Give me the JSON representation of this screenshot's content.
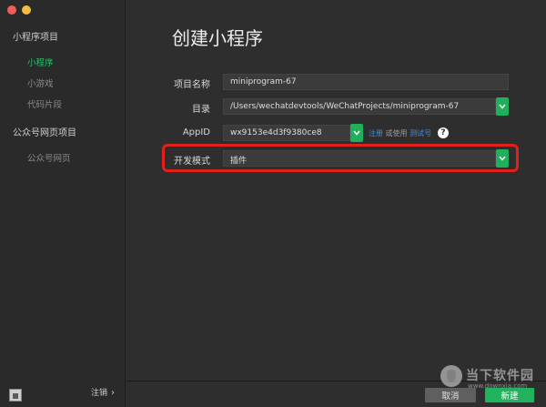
{
  "sidebar": {
    "groups": [
      {
        "title": "小程序项目",
        "items": [
          {
            "label": "小程序",
            "active": true
          },
          {
            "label": "小游戏",
            "active": false
          },
          {
            "label": "代码片段",
            "active": false
          }
        ]
      },
      {
        "title": "公众号网页项目",
        "items": [
          {
            "label": "公众号网页",
            "active": false
          }
        ]
      }
    ],
    "logout_label": "注销",
    "logout_arrow": "›"
  },
  "main": {
    "title": "创建小程序",
    "form": {
      "project_name_label": "项目名称",
      "project_name_value": "miniprogram-67",
      "directory_label": "目录",
      "directory_value": "/Users/wechatdevtools/WeChatProjects/miniprogram-67",
      "appid_label": "AppID",
      "appid_value": "wx9153e4d3f9380ce8",
      "appid_register_link": "注册",
      "appid_or_use": "或使用",
      "appid_test_link": "测试号",
      "help_symbol": "?",
      "dev_mode_label": "开发模式",
      "dev_mode_value": "插件"
    },
    "highlight_color": "#e0211a"
  },
  "footer": {
    "cancel_label": "取消",
    "create_label": "新建"
  },
  "watermark": {
    "text": "当下软件园",
    "url": "www.downxia.com"
  },
  "colors": {
    "accent": "#21b35e",
    "link": "#4a8fd6",
    "background": "#2e2e2e"
  }
}
